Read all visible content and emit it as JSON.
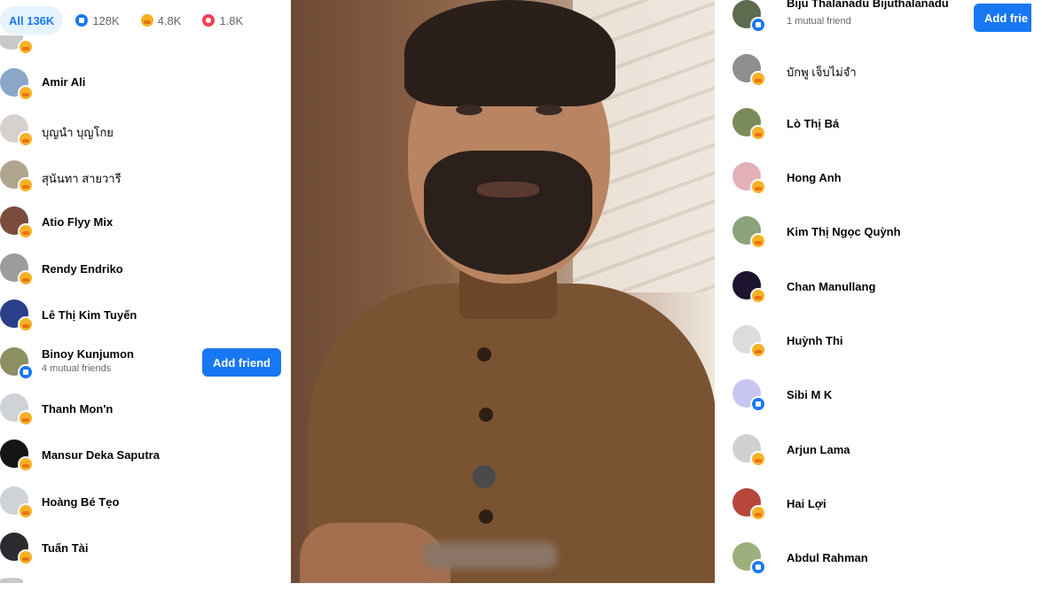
{
  "left_panel": {
    "tabs": [
      {
        "label": "All 136K",
        "icon": "none"
      },
      {
        "label": "128K",
        "icon": "like-icon"
      },
      {
        "label": "4.8K",
        "icon": "care-icon"
      },
      {
        "label": "1.8K",
        "icon": "love-icon"
      }
    ],
    "people": [
      {
        "name": "Amir Ali",
        "reaction": "care"
      },
      {
        "name": "บุญนำ บุญโกย",
        "reaction": "care"
      },
      {
        "name": "สุนันทา สายวารี",
        "reaction": "care"
      },
      {
        "name": "Atio Flyy Mix",
        "reaction": "care"
      },
      {
        "name": "Rendy Endriko",
        "reaction": "care"
      },
      {
        "name": "Lê Thị Kim Tuyến",
        "reaction": "care"
      },
      {
        "name": "Binoy Kunjumon",
        "reaction": "like",
        "mutual": "4 mutual friends",
        "button": "Add friend"
      },
      {
        "name": "Thanh Mon'n",
        "reaction": "care"
      },
      {
        "name": "Mansur Deka Saputra",
        "reaction": "care"
      },
      {
        "name": "Hoàng Bé Tẹo",
        "reaction": "care"
      },
      {
        "name": "Tuấn Tài",
        "reaction": "care"
      }
    ]
  },
  "right_panel": {
    "people": [
      {
        "name": "Biju Thalanadu Bijuthalanadu",
        "reaction": "like",
        "mutual": "1 mutual friend",
        "button": "Add frie"
      },
      {
        "name": "บักพู เจ็บไม่จำ",
        "reaction": "care"
      },
      {
        "name": "Lò Thị Bá",
        "reaction": "care"
      },
      {
        "name": "Hong Anh",
        "reaction": "care"
      },
      {
        "name": "Kim Thị Ngọc Quỳnh",
        "reaction": "care"
      },
      {
        "name": "Chan Manullang",
        "reaction": "care"
      },
      {
        "name": "Huỳnh Thi",
        "reaction": "care"
      },
      {
        "name": "Sibi M K",
        "reaction": "like"
      },
      {
        "name": "Arjun Lama",
        "reaction": "care"
      },
      {
        "name": "Hai Lợi",
        "reaction": "care"
      },
      {
        "name": "Abdul Rahman",
        "reaction": "like"
      }
    ]
  },
  "colors": {
    "accent": "#1877f2",
    "care": "#f7b125",
    "love": "#f33e58"
  }
}
